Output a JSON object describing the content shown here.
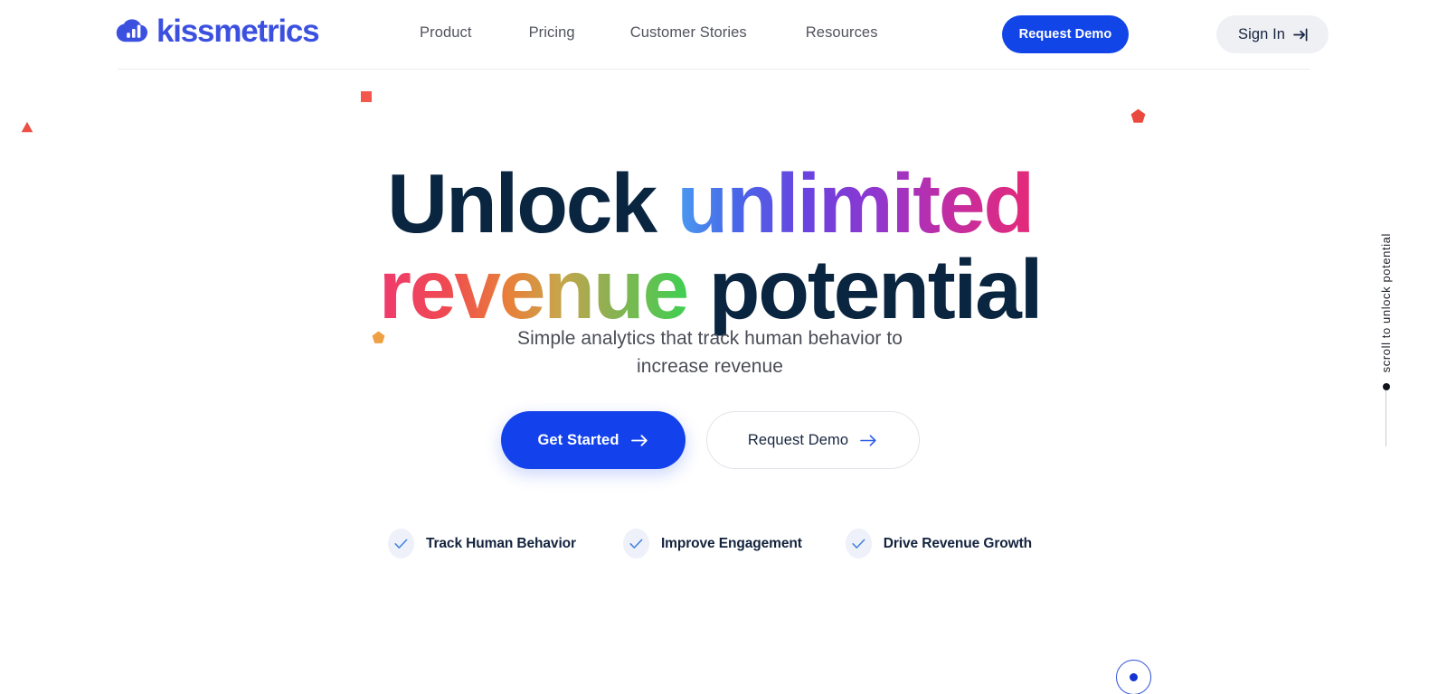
{
  "header": {
    "logo_text": "kissmetrics",
    "logo_icon": "cloud-bar-chart-icon",
    "nav": [
      {
        "label": "Product"
      },
      {
        "label": "Pricing"
      },
      {
        "label": "Customer Stories"
      },
      {
        "label": "Resources"
      }
    ],
    "request_demo_label": "Request Demo",
    "sign_in_label": "Sign In",
    "sign_in_icon": "login-arrow-icon"
  },
  "hero": {
    "headline_part1": "Unlock ",
    "headline_part2": "unlimited",
    "headline_part3": "revenue",
    "headline_part4": " potential",
    "subtitle_line1": "Simple analytics that track human behavior to",
    "subtitle_line2": "increase revenue",
    "cta_primary": "Get Started",
    "cta_primary_icon": "arrow-right-icon",
    "cta_secondary": "Request Demo",
    "cta_secondary_icon": "arrow-right-icon",
    "features": [
      {
        "label": "Track Human Behavior",
        "icon": "check-icon"
      },
      {
        "label": "Improve Engagement",
        "icon": "check-icon"
      },
      {
        "label": "Drive Revenue Growth",
        "icon": "check-icon"
      }
    ]
  },
  "scroll_indicator": {
    "text": "scroll to unlock potential",
    "dot_icon": "scroll-dot-icon"
  },
  "decorations": [
    {
      "name": "square-red",
      "shape": "square",
      "color": "#f4574b"
    },
    {
      "name": "pentagon-red",
      "shape": "pentagon",
      "color": "#ea4a3d"
    },
    {
      "name": "pentagon-orange",
      "shape": "pentagon",
      "color": "#f0a044"
    },
    {
      "name": "triangle-red",
      "shape": "triangle",
      "color": "#ea5044"
    }
  ],
  "scroll_button": {
    "icon": "scroll-down-circle-icon"
  },
  "colors": {
    "brand_blue": "#3c50e0",
    "cta_blue": "#1342ec",
    "headline_dark": "#0a2540",
    "signin_bg": "#eff0f4",
    "check_bg": "#eef0fa"
  }
}
